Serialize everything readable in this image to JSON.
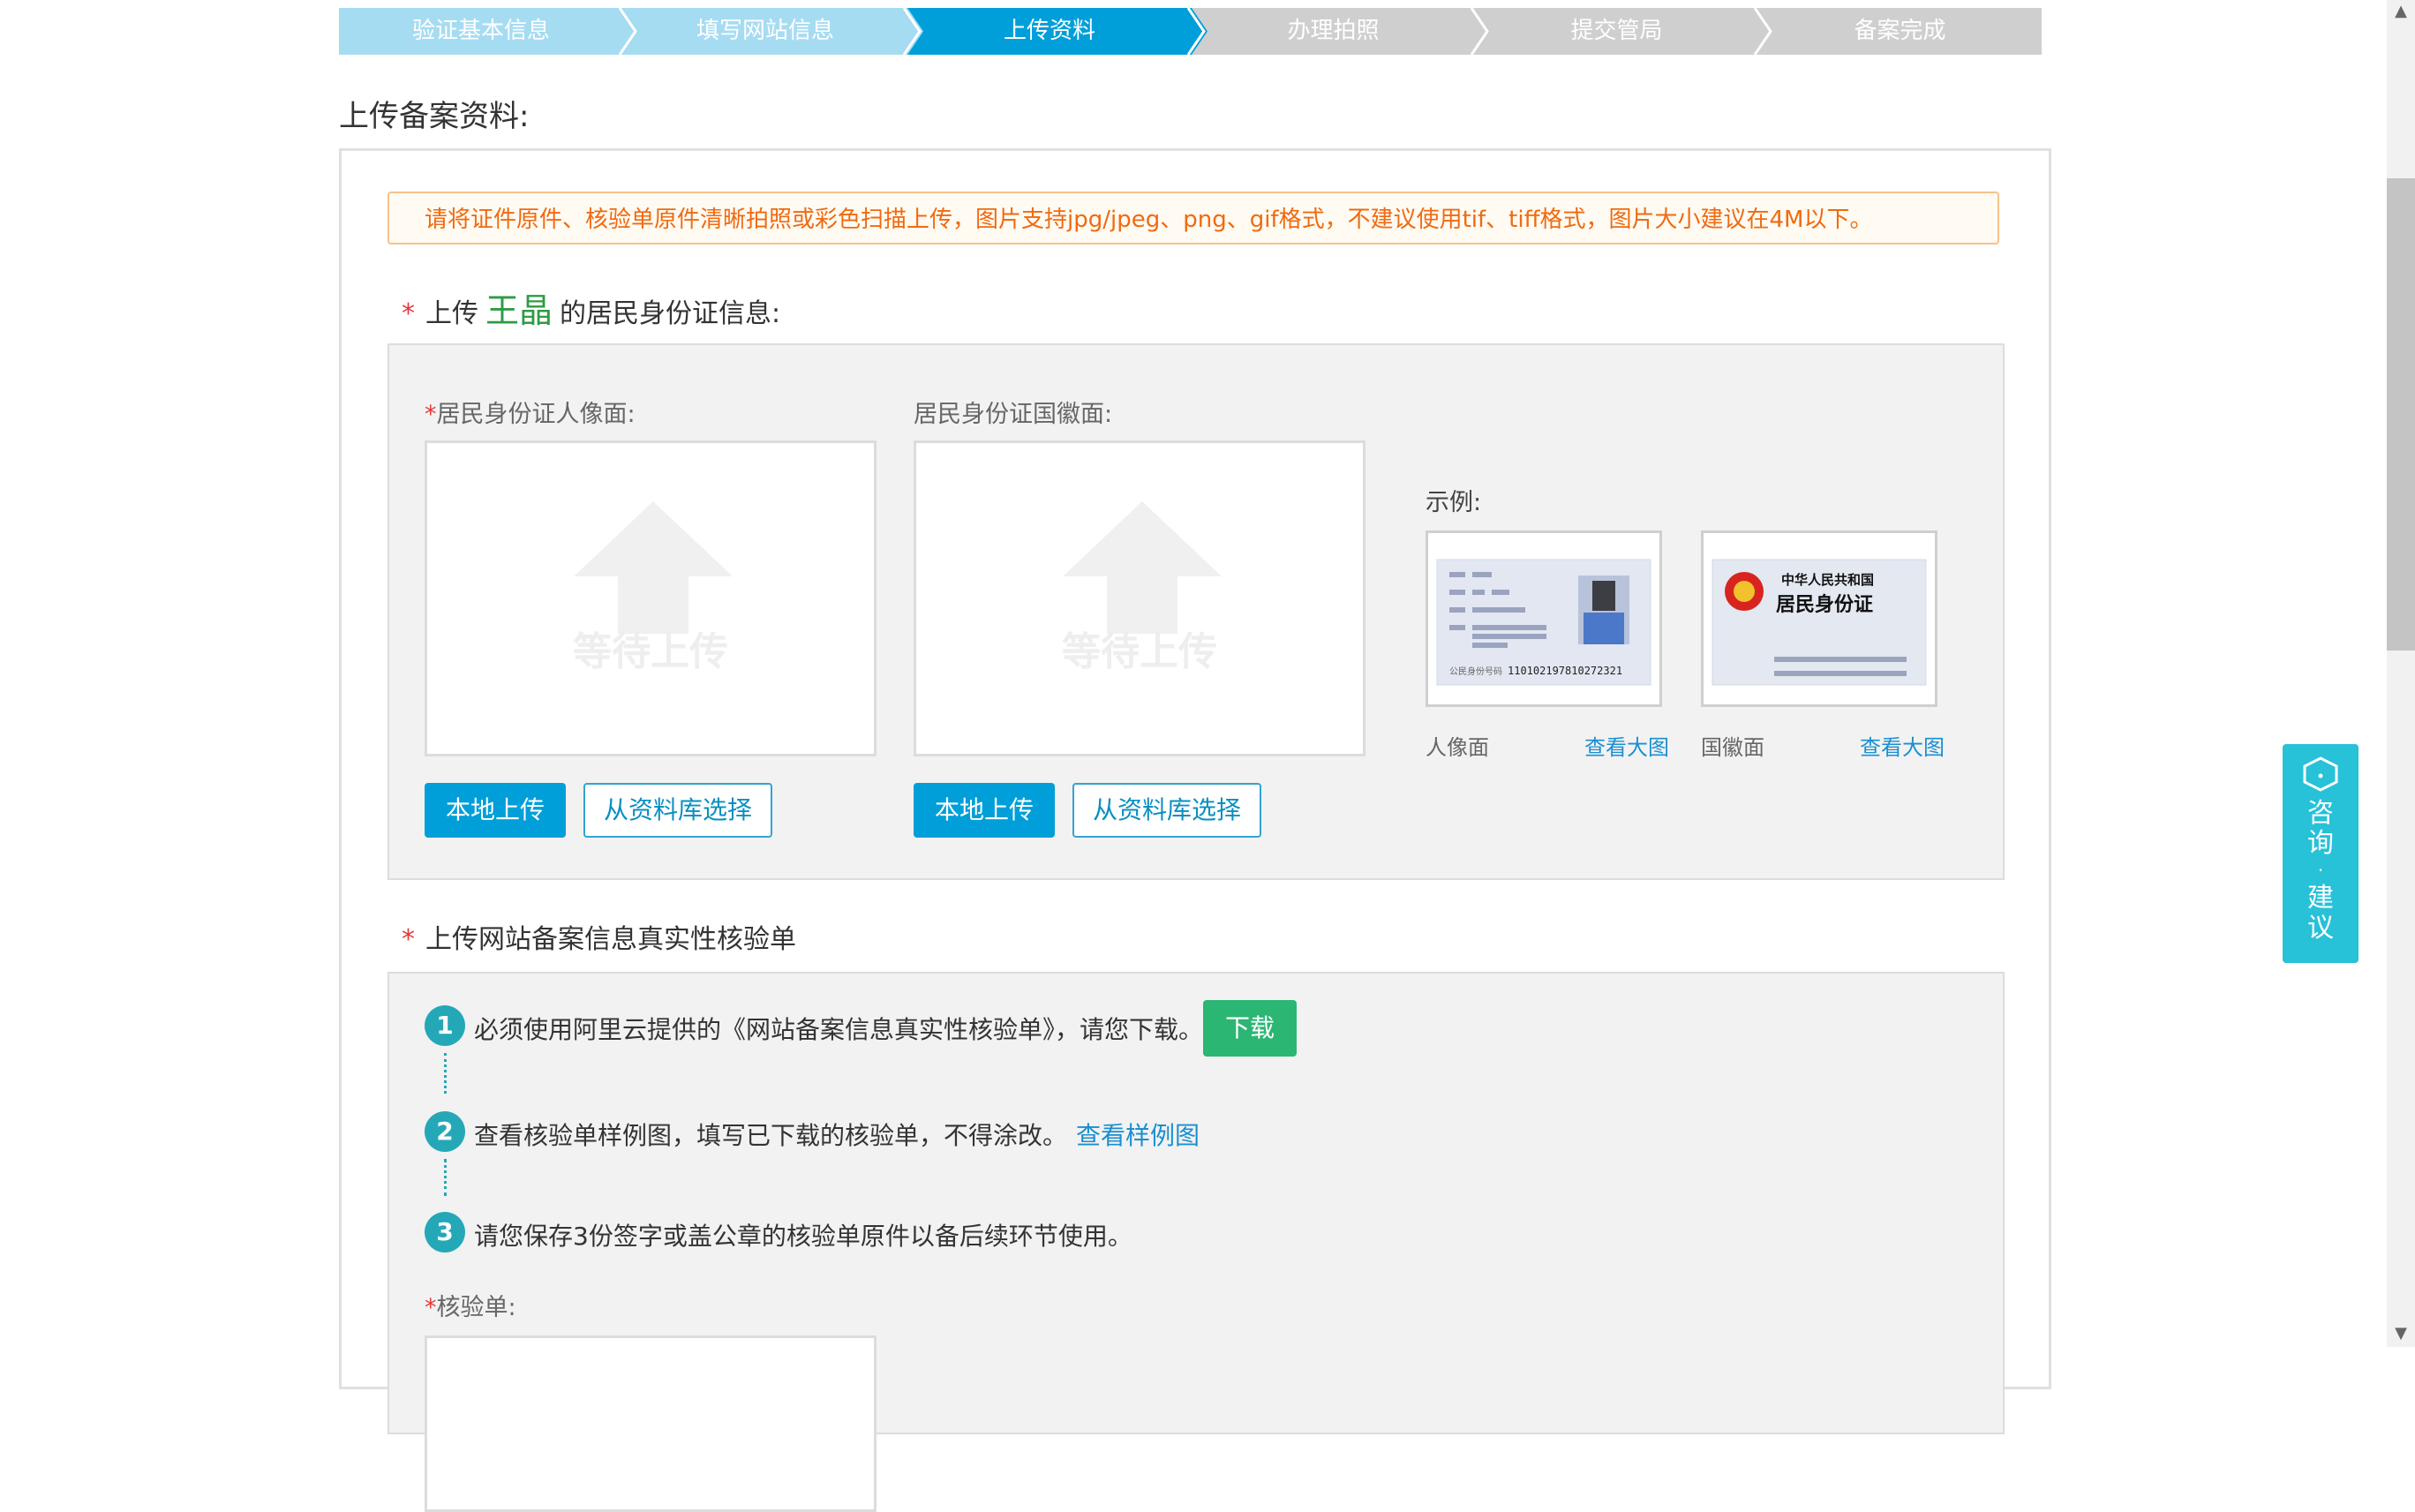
{
  "steps": [
    {
      "label": "验证基本信息",
      "state": "done"
    },
    {
      "label": "填写网站信息",
      "state": "done"
    },
    {
      "label": "上传资料",
      "state": "active"
    },
    {
      "label": "办理拍照",
      "state": "todo"
    },
    {
      "label": "提交管局",
      "state": "todo"
    },
    {
      "label": "备案完成",
      "state": "todo"
    }
  ],
  "page_title": "上传备案资料:",
  "notice": "请将证件原件、核验单原件清晰拍照或彩色扫描上传，图片支持jpg/jpeg、png、gif格式，不建议使用tif、tiff格式，图片大小建议在4M以下。",
  "id_section": {
    "required_mark": "*",
    "prefix": "上传",
    "person_name": "王晶",
    "suffix": "的居民身份证信息:",
    "front": {
      "required_mark": "*",
      "label": "居民身份证人像面:",
      "placeholder": "等待上传",
      "local_upload": "本地上传",
      "from_library": "从资料库选择"
    },
    "back": {
      "label": "居民身份证国徽面:",
      "placeholder": "等待上传",
      "local_upload": "本地上传",
      "from_library": "从资料库选择"
    },
    "example": {
      "label": "示例:",
      "front_caption": "人像面",
      "back_caption": "国徽面",
      "view_large": "查看大图",
      "card_front_number": "110102197810272321",
      "card_back_title_1": "中华人民共和国",
      "card_back_title_2": "居民身份证"
    }
  },
  "verify_section": {
    "required_mark": "*",
    "title": "上传网站备案信息真实性核验单",
    "steps": [
      {
        "num": "1",
        "text": "必须使用阿里云提供的《网站备案信息真实性核验单》，请您下载。"
      },
      {
        "num": "2",
        "text": "查看核验单样例图，填写已下载的核验单，不得涂改。"
      },
      {
        "num": "3",
        "text": "请您保存3份签字或盖公章的核验单原件以备后续环节使用。"
      }
    ],
    "download_button": "下载",
    "sample_link": "查看样例图",
    "field_required_mark": "*",
    "field_label": "核验单:"
  },
  "consult": {
    "line1": "咨",
    "line2": "询",
    "dot": "·",
    "line3": "建",
    "line4": "议"
  },
  "colors": {
    "accent": "#009fd9",
    "done": "#a6dcf2",
    "todo": "#cfcfcf",
    "notice_text": "#f06a10",
    "green": "#2bb673",
    "teal": "#24a8b8"
  }
}
